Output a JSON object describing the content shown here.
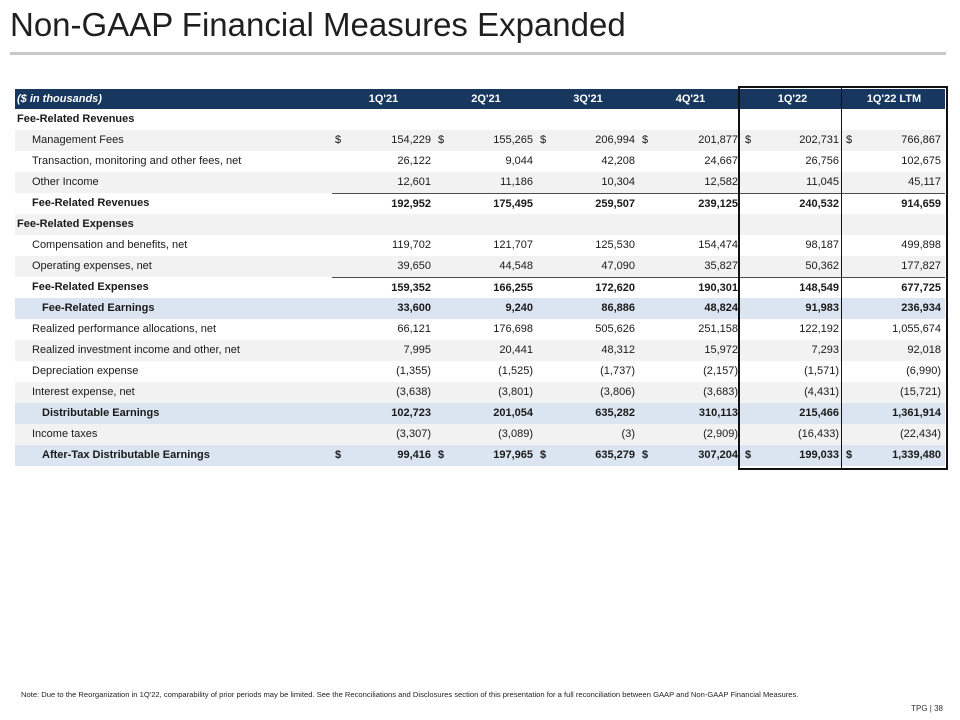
{
  "title": "Non-GAAP Financial Measures Expanded",
  "header": {
    "label": "($ in thousands)",
    "columns": [
      "1Q'21",
      "2Q'21",
      "3Q'21",
      "4Q'21",
      "1Q'22",
      "1Q'22 LTM"
    ]
  },
  "rows": [
    {
      "label": "Fee-Related Revenues",
      "style": "section",
      "values": []
    },
    {
      "label": "Management Fees",
      "style": "item",
      "currency": true,
      "values": [
        "154,229",
        "155,265",
        "206,994",
        "201,877",
        "202,731",
        "766,867"
      ]
    },
    {
      "label": "Transaction, monitoring and other fees, net",
      "style": "item",
      "values": [
        "26,122",
        "9,044",
        "42,208",
        "24,667",
        "26,756",
        "102,675"
      ]
    },
    {
      "label": "Other Income",
      "style": "item",
      "values": [
        "12,601",
        "11,186",
        "10,304",
        "12,582",
        "11,045",
        "45,117"
      ]
    },
    {
      "label": "Fee-Related Revenues",
      "style": "total",
      "values": [
        "192,952",
        "175,495",
        "259,507",
        "239,125",
        "240,532",
        "914,659"
      ]
    },
    {
      "label": "Fee-Related Expenses",
      "style": "section",
      "values": []
    },
    {
      "label": "Compensation and benefits, net",
      "style": "item",
      "values": [
        "119,702",
        "121,707",
        "125,530",
        "154,474",
        "98,187",
        "499,898"
      ]
    },
    {
      "label": "Operating expenses, net",
      "style": "item",
      "values": [
        "39,650",
        "44,548",
        "47,090",
        "35,827",
        "50,362",
        "177,827"
      ]
    },
    {
      "label": "Fee-Related Expenses",
      "style": "total",
      "values": [
        "159,352",
        "166,255",
        "172,620",
        "190,301",
        "148,549",
        "677,725"
      ]
    },
    {
      "label": "Fee-Related Earnings",
      "style": "subtotal",
      "values": [
        "33,600",
        "9,240",
        "86,886",
        "48,824",
        "91,983",
        "236,934"
      ]
    },
    {
      "label": "Realized performance allocations, net",
      "style": "item",
      "values": [
        "66,121",
        "176,698",
        "505,626",
        "251,158",
        "122,192",
        "1,055,674"
      ]
    },
    {
      "label": "Realized investment income and other, net",
      "style": "item",
      "values": [
        "7,995",
        "20,441",
        "48,312",
        "15,972",
        "7,293",
        "92,018"
      ]
    },
    {
      "label": "Depreciation expense",
      "style": "item",
      "values": [
        "(1,355)",
        "(1,525)",
        "(1,737)",
        "(2,157)",
        "(1,571)",
        "(6,990)"
      ]
    },
    {
      "label": "Interest expense, net",
      "style": "item",
      "values": [
        "(3,638)",
        "(3,801)",
        "(3,806)",
        "(3,683)",
        "(4,431)",
        "(15,721)"
      ]
    },
    {
      "label": "Distributable Earnings",
      "style": "subtotal",
      "values": [
        "102,723",
        "201,054",
        "635,282",
        "310,113",
        "215,466",
        "1,361,914"
      ]
    },
    {
      "label": "Income taxes",
      "style": "item",
      "values": [
        "(3,307)",
        "(3,089)",
        "(3)",
        "(2,909)",
        "(16,433)",
        "(22,434)"
      ]
    },
    {
      "label": "After-Tax Distributable Earnings",
      "style": "subtotal",
      "currency": true,
      "values": [
        "99,416",
        "197,965",
        "635,279",
        "307,204",
        "199,033",
        "1,339,480"
      ]
    }
  ],
  "currency_symbol": "$",
  "note": "Note: Due to the Reorganization in 1Q'22, comparability of prior periods may be limited. See the Reconciliations and Disclosures section of this presentation for a full reconciliation between GAAP and Non-GAAP Financial Measures.",
  "footer": "TPG | 38",
  "colors": {
    "header_bg": "#17375e",
    "highlight_bg": "#dbe5f1",
    "stripe_bg": "#f2f2f2"
  }
}
